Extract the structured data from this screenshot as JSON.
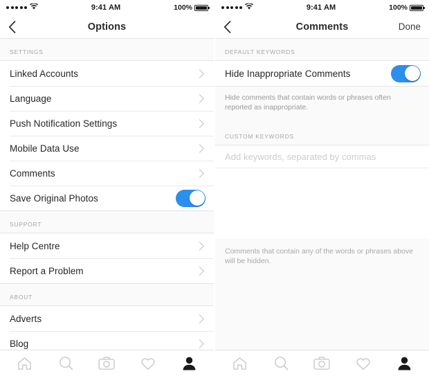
{
  "status_bar": {
    "signal_dots": 5,
    "wifi_icon": "wifi-icon",
    "time": "9:41 AM",
    "battery_percent": "100%",
    "battery_icon": "battery-full-icon"
  },
  "left_screen": {
    "nav": {
      "back_icon": "chevron-left-icon",
      "title": "Options"
    },
    "sections": [
      {
        "header": "SETTINGS",
        "rows": [
          {
            "label": "Linked Accounts",
            "accessory": "chevron"
          },
          {
            "label": "Language",
            "accessory": "chevron"
          },
          {
            "label": "Push Notification Settings",
            "accessory": "chevron"
          },
          {
            "label": "Mobile Data Use",
            "accessory": "chevron"
          },
          {
            "label": "Comments",
            "accessory": "chevron"
          },
          {
            "label": "Save Original Photos",
            "accessory": "toggle",
            "toggle_on": true
          }
        ]
      },
      {
        "header": "SUPPORT",
        "rows": [
          {
            "label": "Help Centre",
            "accessory": "chevron"
          },
          {
            "label": "Report a Problem",
            "accessory": "chevron"
          }
        ]
      },
      {
        "header": "ABOUT",
        "rows": [
          {
            "label": "Adverts",
            "accessory": "chevron"
          },
          {
            "label": "Blog",
            "accessory": "chevron"
          }
        ]
      }
    ]
  },
  "right_screen": {
    "nav": {
      "back_icon": "chevron-left-icon",
      "title": "Comments",
      "done_label": "Done"
    },
    "default_keywords": {
      "header": "DEFAULT KEYWORDS",
      "row_label": "Hide Inappropriate Comments",
      "toggle_on": true,
      "description": "Hide comments that contain words or phrases often reported as inappropriate."
    },
    "custom_keywords": {
      "header": "CUSTOM KEYWORDS",
      "input_value": "",
      "input_placeholder": "Add keywords, separated by commas",
      "footnote": "Comments that contain any of the words or phrases above will be hidden."
    }
  },
  "tab_bar": {
    "items": [
      {
        "icon": "home-icon",
        "active": false
      },
      {
        "icon": "search-icon",
        "active": false
      },
      {
        "icon": "camera-icon",
        "active": false
      },
      {
        "icon": "heart-icon",
        "active": false
      },
      {
        "icon": "profile-icon",
        "active": true
      }
    ]
  },
  "colors": {
    "toggle_on": "#2b8fed",
    "text_primary": "#262626",
    "text_muted": "#a6a6a6",
    "background": "#fafafa"
  }
}
